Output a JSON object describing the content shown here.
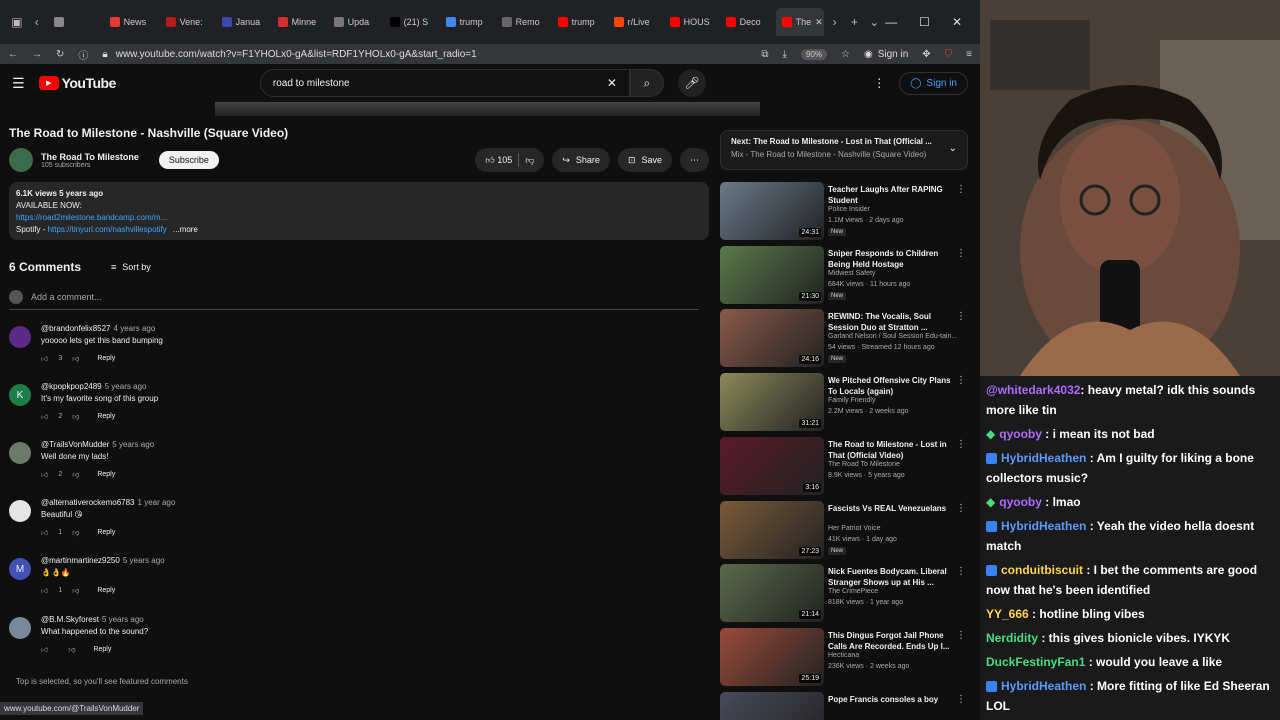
{
  "browser": {
    "tabs": [
      {
        "label": "",
        "color": "#888888"
      },
      {
        "label": "News",
        "color": "#e53935"
      },
      {
        "label": "Vene:",
        "color": "#b71c1c"
      },
      {
        "label": "Janua",
        "color": "#3949ab"
      },
      {
        "label": "Minne",
        "color": "#d32f2f"
      },
      {
        "label": "Upda",
        "color": "#777777"
      },
      {
        "label": "(21) S",
        "color": "#000000"
      },
      {
        "label": "trump",
        "color": "#4285f4"
      },
      {
        "label": "Remo",
        "color": "#666666"
      },
      {
        "label": "trump",
        "color": "#ff0000"
      },
      {
        "label": "r/Live",
        "color": "#ff4500"
      },
      {
        "label": "HOUS",
        "color": "#ff0000"
      },
      {
        "label": "Deco",
        "color": "#ff0000"
      },
      {
        "label": "The",
        "color": "#ff0000"
      }
    ],
    "url": "www.youtube.com/watch?v=F1YHOLx0-gA&list=RDF1YHOLx0-gA&start_radio=1",
    "zoom": "90%",
    "signin": "Sign in",
    "status_url": "www.youtube.com/@TrailsVonMudder"
  },
  "yt_header": {
    "logo": "YouTube",
    "search_query": "road to milestone",
    "signin": "Sign in"
  },
  "video": {
    "title": "The Road to Milestone - Nashville (Square Video)",
    "channel": "The Road To Milestone",
    "subscribers": "105 subscribers",
    "subscribe_label": "Subscribe",
    "likes": "105",
    "share_label": "Share",
    "save_label": "Save",
    "stats": "6.1K views  5 years ago",
    "desc_line1": "AVAILABLE NOW:",
    "desc_link1": "https://road2milestone.bandcamp.com/m...",
    "desc_spotify": "Spotify - ",
    "desc_link2": "https://tinyurl.com/nashvillespotify",
    "more": "...more"
  },
  "comments": {
    "count_label": "6 Comments",
    "sort_label": "Sort by",
    "add_placeholder": "Add a comment...",
    "reply_label": "Reply",
    "items": [
      {
        "author": "@brandonfelix8527",
        "time": "4 years ago",
        "text": "yooooo lets get this band bumping",
        "likes": "3",
        "avatar_letter": "",
        "avatar_color": "#5b2a86"
      },
      {
        "author": "@kpopkpop2489",
        "time": "5 years ago",
        "text": "It's my favorite song of this group",
        "likes": "2",
        "avatar_letter": "K",
        "avatar_color": "#1e7e4a"
      },
      {
        "author": "@TrailsVonMudder",
        "time": "5 years ago",
        "text": "Well done my lads!",
        "likes": "2",
        "avatar_letter": "",
        "avatar_color": "#6b7a6b"
      },
      {
        "author": "@alternativerockemo6783",
        "time": "1 year ago",
        "text": "Beautiful 😘",
        "likes": "1",
        "avatar_letter": "",
        "avatar_color": "#e6e6e6"
      },
      {
        "author": "@martinmartinez9250",
        "time": "5 years ago",
        "text": "👌👌🔥",
        "likes": "1",
        "avatar_letter": "M",
        "avatar_color": "#3f51b5"
      },
      {
        "author": "@B.M.Skyforest",
        "time": "5 years ago",
        "text": "What happened to the sound?",
        "likes": "",
        "avatar_letter": "",
        "avatar_color": "#7a8a9a"
      }
    ],
    "featured_note": "Top is selected, so you'll see featured comments"
  },
  "sidebar": {
    "next_title": "Next: The Road to Milestone - Lost in That (Official ...",
    "next_sub": "Mix - The Road to Milestone - Nashville (Square Video)",
    "recs": [
      {
        "title": "Teacher Laughs After RAPING Student",
        "channel": "Police Insider",
        "views": "1.1M views · 2 days ago",
        "duration": "24:31",
        "is_new": "New",
        "color": "#6a7a8a"
      },
      {
        "title": "Sniper Responds to Children Being Held Hostage",
        "channel": "Midwest Safety",
        "views": "684K views · 11 hours ago",
        "duration": "21:30",
        "is_new": "New",
        "color": "#5a7a4a"
      },
      {
        "title": "REWIND: The Vocalis, Soul Session Duo at Stratton ...",
        "channel": "Garland Nelson / Soul Session Edu-tain...",
        "views": "54 views · Streamed 12 hours ago",
        "duration": "24:16",
        "is_new": "New",
        "color": "#8a5a4a"
      },
      {
        "title": "We Pitched Offensive City Plans To Locals (again)",
        "channel": "Family Friendly",
        "views": "2.2M views · 2 weeks ago",
        "duration": "31:21",
        "is_new": "",
        "color": "#8a8a5a"
      },
      {
        "title": "The Road to Milestone - Lost in That (Official Video)",
        "channel": "The Road To Milestone",
        "views": "8.9K views · 5 years ago",
        "duration": "3:16",
        "is_new": "",
        "color": "#5a1a2a"
      },
      {
        "title": "Fascists Vs REAL Venezuelans",
        "channel": "Her Patriot Voice",
        "views": "41K views · 1 day ago",
        "duration": "27:23",
        "is_new": "New",
        "color": "#7a5a3a"
      },
      {
        "title": "Nick Fuentes Bodycam. Liberal Stranger Shows up at His ...",
        "channel": "The CrimePiece",
        "views": "818K views · 1 year ago",
        "duration": "21:14",
        "is_new": "",
        "color": "#5a6a4a"
      },
      {
        "title": "This Dingus Forgot Jail Phone Calls Are Recorded. Ends Up I...",
        "channel": "Hecticana",
        "views": "236K views · 2 weeks ago",
        "duration": "25:19",
        "is_new": "",
        "color": "#9a4a3a"
      },
      {
        "title": "Pope Francis consoles a boy",
        "channel": "",
        "views": "",
        "duration": "",
        "is_new": "",
        "color": "#4a4a5a"
      }
    ]
  },
  "chat": [
    {
      "user": "@whitedark4032",
      "text": ": heavy metal? idk this sounds more like tin",
      "color": "#b06cff",
      "badge": ""
    },
    {
      "user": "qyooby",
      "text": " : i mean its not bad",
      "color": "#b06cff",
      "badge": "diamond"
    },
    {
      "user": "HybridHeathen",
      "text": " : Am I guilty for liking a bone collectors music?",
      "color": "#5b9bff",
      "badge": "box"
    },
    {
      "user": "qyooby",
      "text": " : lmao",
      "color": "#b06cff",
      "badge": "diamond"
    },
    {
      "user": "HybridHeathen",
      "text": " : Yeah the video hella doesnt match",
      "color": "#5b9bff",
      "badge": "box"
    },
    {
      "user": "conduitbiscuit",
      "text": " : I bet the comments are good now that he's been identified",
      "color": "#ffd54f",
      "badge": "box"
    },
    {
      "user": "YY_666",
      "text": " : hotline bling vibes",
      "color": "#ffd54f",
      "badge": ""
    },
    {
      "user": "Nerdidity",
      "text": " : this gives bionicle vibes. IYKYK",
      "color": "#4ade80",
      "badge": ""
    },
    {
      "user": "DuckFestinyFan1",
      "text": " : would you leave a like",
      "color": "#4ade80",
      "badge": ""
    },
    {
      "user": "HybridHeathen",
      "text": " : More fitting of like Ed Sheeran LOL",
      "color": "#5b9bff",
      "badge": "box"
    }
  ]
}
